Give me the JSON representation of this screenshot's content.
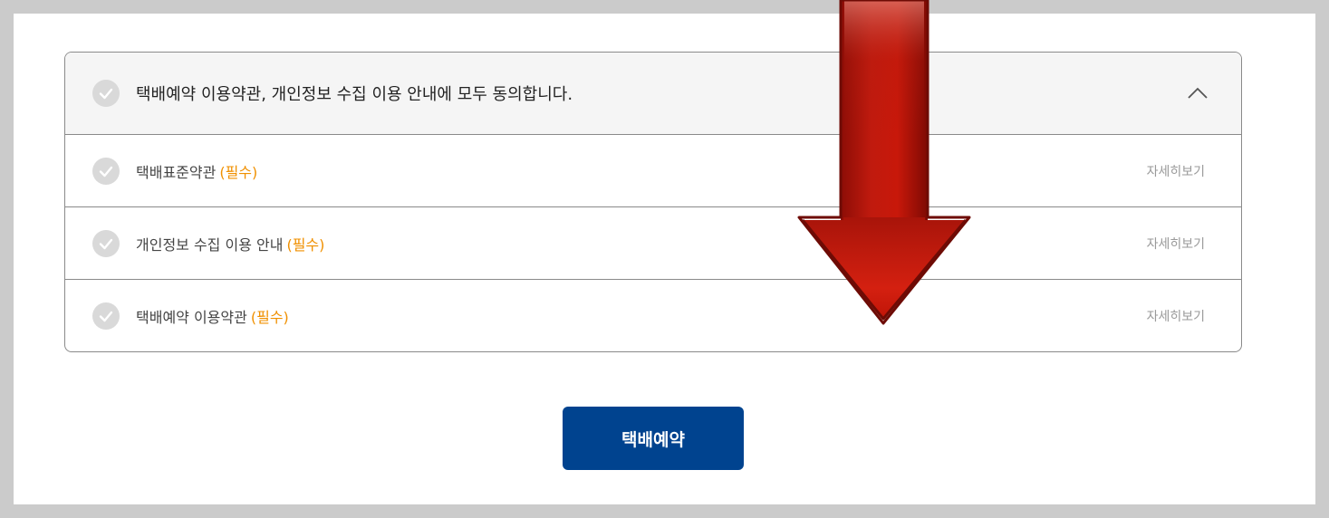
{
  "agreement": {
    "all_label": "택배예약 이용약관, 개인정보 수집 이용 안내에 모두 동의합니다.",
    "items": [
      {
        "label": "택배표준약관",
        "required": "(필수)",
        "detail": "자세히보기"
      },
      {
        "label": "개인정보 수집 이용 안내",
        "required": "(필수)",
        "detail": "자세히보기"
      },
      {
        "label": "택배예약 이용약관",
        "required": "(필수)",
        "detail": "자세히보기"
      }
    ]
  },
  "submit_label": "택배예약",
  "colors": {
    "primary": "#00438f",
    "required": "#f09000",
    "check_off": "#d9d9d9",
    "arrow": "#c8140a"
  },
  "icons": {
    "check": "checkmark-icon",
    "toggle": "chevron-up-icon",
    "annotation": "down-arrow-icon"
  }
}
